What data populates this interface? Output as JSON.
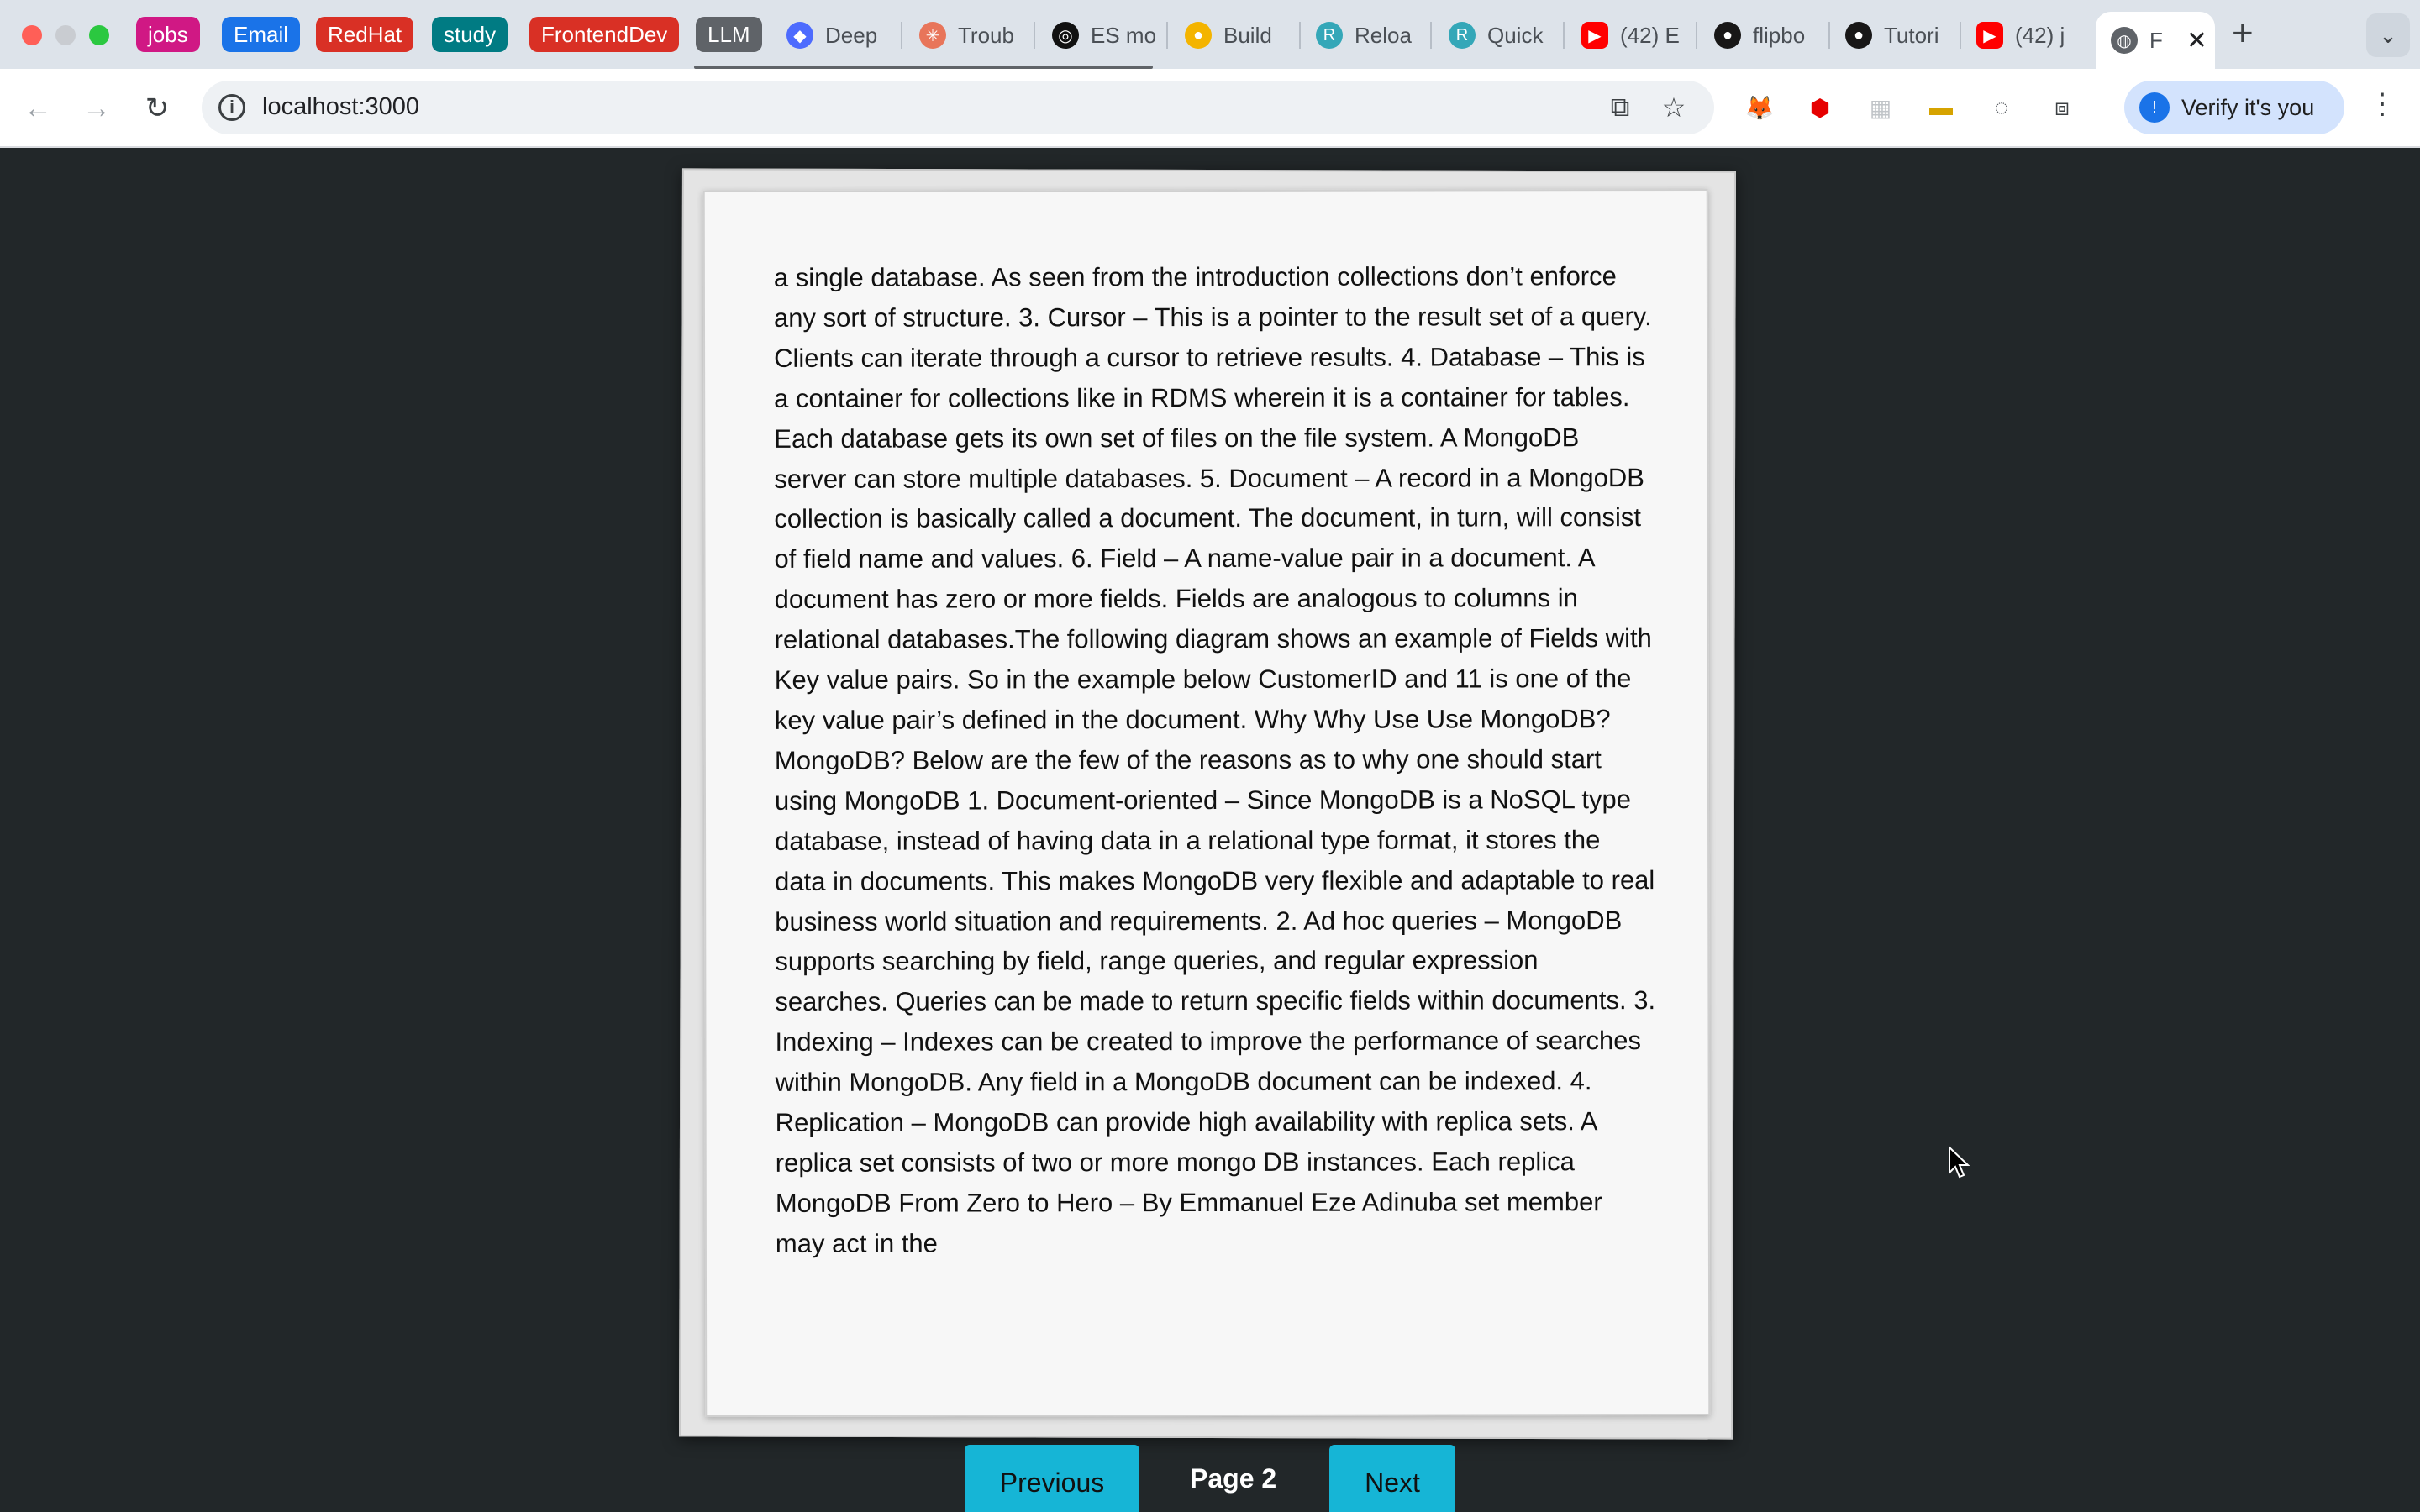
{
  "browser": {
    "tab_groups": [
      {
        "label": "jobs",
        "color": "#d01884"
      },
      {
        "label": "Email",
        "color": "#1a73e8"
      },
      {
        "label": "RedHat",
        "color": "#d93025"
      },
      {
        "label": "study",
        "color": "#007b83"
      },
      {
        "label": "FrontendDev",
        "color": "#d93025"
      },
      {
        "label": "LLM",
        "color": "#5f6368"
      }
    ],
    "tabs": [
      {
        "title": "Deep",
        "icon": "deepseek-icon"
      },
      {
        "title": "Troub",
        "icon": "claude-icon"
      },
      {
        "title": "ES mo",
        "icon": "openai-icon"
      },
      {
        "title": "Build",
        "icon": "google-ai-icon"
      },
      {
        "title": "Reloa",
        "icon": "remix-icon"
      },
      {
        "title": "Quick",
        "icon": "remix-icon"
      },
      {
        "title": "(42) E",
        "icon": "youtube-icon"
      },
      {
        "title": "flipbo",
        "icon": "github-icon"
      },
      {
        "title": "Tutori",
        "icon": "github-icon"
      },
      {
        "title": "(42) j",
        "icon": "youtube-icon"
      }
    ],
    "active_tab": {
      "title": "F",
      "icon": "globe-icon"
    },
    "url": "localhost:3000",
    "verify_label": "Verify it's you"
  },
  "book": {
    "page_text": "a single database. As seen from the introduction collections don’t enforce any sort of structure. 3. Cursor – This is a pointer to the result set of a query. Clients can iterate through a cursor to retrieve results. 4. Database – This is a container for collections like in RDMS wherein it is a container for tables. Each database gets its own set of files on the file system. A MongoDB server can store multiple databases. 5. Document – A record in a MongoDB collection is basically called a document. The document, in turn, will consist of field name and values. 6. Field – A name-value pair in a document. A document has zero or more fields. Fields are analogous to columns in relational databases.The following diagram shows an example of Fields with Key value pairs. So in the example below CustomerID and 11 is one of the key value pair’s defined in the document. Why Why Use Use MongoDB?MongoDB? Below are the few of the reasons as to why one should start using MongoDB 1. Document-oriented – Since MongoDB is a NoSQL type database, instead of having data in a relational type format, it stores the data in documents. This makes MongoDB very flexible and adaptable to real business world situation and requirements. 2. Ad hoc queries – MongoDB supports searching by field, range queries, and regular expression searches. Queries can be made to return specific fields within documents. 3. Indexing – Indexes can be created to improve the performance of searches within MongoDB. Any field in a MongoDB document can be indexed. 4. Replication – MongoDB can provide high availability with replica sets. A replica set consists of two or more mongo DB instances. Each replica MongoDB From Zero to Hero – By Emmanuel Eze Adinuba set member may act in the"
  },
  "pager": {
    "prev_label": "Previous",
    "page_label": "Page 2",
    "next_label": "Next"
  }
}
